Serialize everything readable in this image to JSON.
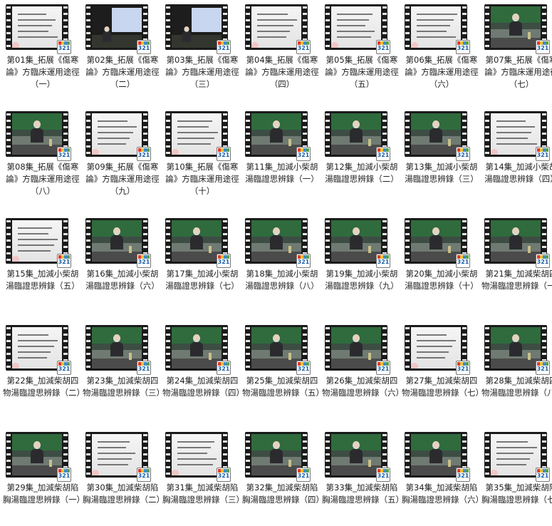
{
  "items": [
    {
      "title": "第01集_拓展《傷寒論》方臨床運用途徑（一）",
      "badge": "321",
      "thumb": "text"
    },
    {
      "title": "第02集_拓展《傷寒論》方臨床運用途徑（二）",
      "badge": "321",
      "thumb": "screen"
    },
    {
      "title": "第03集_拓展《傷寒論》方臨床運用途徑（三）",
      "badge": "321",
      "thumb": "screen"
    },
    {
      "title": "第04集_拓展《傷寒論》方臨床運用途徑（四）",
      "badge": "321",
      "thumb": "text"
    },
    {
      "title": "第05集_拓展《傷寒論》方臨床運用途徑（五）",
      "badge": "321",
      "thumb": "text"
    },
    {
      "title": "第06集_拓展《傷寒論》方臨床運用途徑（六）",
      "badge": "321",
      "thumb": "text"
    },
    {
      "title": "第07集_拓展《傷寒論》方臨床運用途徑（七）",
      "badge": "321",
      "thumb": "lecture"
    },
    {
      "title": "第08集_拓展《傷寒論》方臨床運用途徑（八）",
      "badge": "321",
      "thumb": "lecture"
    },
    {
      "title": "第09集_拓展《傷寒論》方臨床運用途徑（九）",
      "badge": "321",
      "thumb": "text"
    },
    {
      "title": "第10集_拓展《傷寒論》方臨床運用途徑（十）",
      "badge": "321",
      "thumb": "text"
    },
    {
      "title": "第11集_加減小柴胡湯臨證思辨錄（一）",
      "badge": "321",
      "thumb": "lecture"
    },
    {
      "title": "第12集_加減小柴胡湯臨證思辨錄（二）",
      "badge": "321",
      "thumb": "lecture"
    },
    {
      "title": "第13集_加減小柴胡湯臨證思辨錄（三）",
      "badge": "321",
      "thumb": "lecture"
    },
    {
      "title": "第14集_加減小柴胡湯臨證思辨錄（四）",
      "badge": "321",
      "thumb": "text"
    },
    {
      "title": "第15集_加減小柴胡湯臨證思辨錄（五）",
      "badge": "321",
      "thumb": "text"
    },
    {
      "title": "第16集_加減小柴胡湯臨證思辨錄（六）",
      "badge": "321",
      "thumb": "lecture"
    },
    {
      "title": "第17集_加減小柴胡湯臨證思辨錄（七）",
      "badge": "321",
      "thumb": "lecture"
    },
    {
      "title": "第18集_加減小柴胡湯臨證思辨錄（八）",
      "badge": "321",
      "thumb": "lecture"
    },
    {
      "title": "第19集_加減小柴胡湯臨證思辨錄（九）",
      "badge": "321",
      "thumb": "lecture"
    },
    {
      "title": "第20集_加減小柴胡湯臨證思辨錄（十）",
      "badge": "321",
      "thumb": "lecture"
    },
    {
      "title": "第21集_加減柴胡四物湯臨證思辨錄（一）",
      "badge": "321",
      "thumb": "lecture"
    },
    {
      "title": "第22集_加減柴胡四物湯臨證思辨錄（二）",
      "badge": "321",
      "thumb": "text"
    },
    {
      "title": "第23集_加減柴胡四物湯臨證思辨錄（三）",
      "badge": "321",
      "thumb": "lecture"
    },
    {
      "title": "第24集_加減柴胡四物湯臨證思辨錄（四）",
      "badge": "321",
      "thumb": "lecture"
    },
    {
      "title": "第25集_加減柴胡四物湯臨證思辨錄（五）",
      "badge": "321",
      "thumb": "lecture"
    },
    {
      "title": "第26集_加減柴胡四物湯臨證思辨錄（六）",
      "badge": "321",
      "thumb": "lecture"
    },
    {
      "title": "第27集_加減柴胡四物湯臨證思辨錄（七）",
      "badge": "321",
      "thumb": "text"
    },
    {
      "title": "第28集_加減柴胡四物湯臨證思辨錄（八）",
      "badge": "321",
      "thumb": "lecture"
    },
    {
      "title": "第29集_加減柴胡陷胸湯臨證思辨錄（一）",
      "badge": "321",
      "thumb": "lecture"
    },
    {
      "title": "第30集_加減柴胡陷胸湯臨證思辨錄（二）",
      "badge": "321",
      "thumb": "text"
    },
    {
      "title": "第31集_加減柴胡陷胸湯臨證思辨錄（三）",
      "badge": "321",
      "thumb": "text"
    },
    {
      "title": "第32集_加減柴胡陷胸湯臨證思辨錄（四）",
      "badge": "321",
      "thumb": "lecture"
    },
    {
      "title": "第33集_加減柴胡陷胸湯臨證思辨錄（五）",
      "badge": "321",
      "thumb": "lecture"
    },
    {
      "title": "第34集_加減柴胡陷胸湯臨證思辨錄（六）",
      "badge": "321",
      "thumb": "lecture"
    },
    {
      "title": "第35集_加減柴胡陷胸湯臨證思辨錄（七）",
      "badge": "321",
      "thumb": "text"
    }
  ]
}
